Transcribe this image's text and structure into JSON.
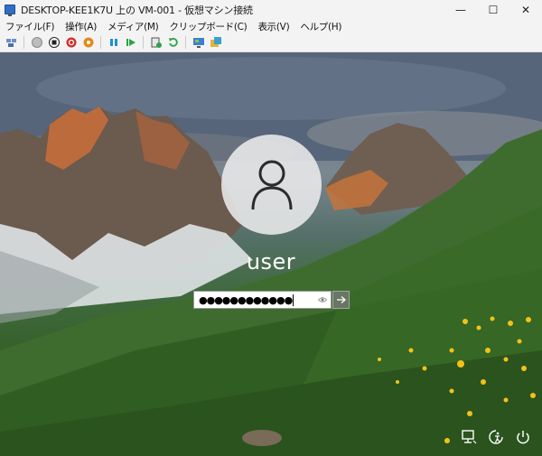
{
  "window": {
    "title": "DESKTOP-KEE1K7U 上の VM-001 - 仮想マシン接続",
    "minimize_glyph": "—",
    "maximize_glyph": "☐",
    "close_glyph": "✕"
  },
  "menu": {
    "items": [
      "ファイル(F)",
      "操作(A)",
      "メディア(M)",
      "クリップボード(C)",
      "表示(V)",
      "ヘルプ(H)"
    ]
  },
  "toolbar": {
    "icons": [
      "ctrl-alt-del-icon",
      "start-icon",
      "turn-off-icon",
      "shutdown-icon",
      "save-icon",
      "pause-icon",
      "resume-icon",
      "checkpoint-icon",
      "revert-icon",
      "enhanced-session-icon",
      "share-icon"
    ]
  },
  "login": {
    "username": "user",
    "password_mask": "●●●●●●●●●●●●",
    "reveal_icon": "eye-icon",
    "submit_icon": "arrow-right-icon"
  },
  "corner": {
    "icons": [
      "network-icon",
      "accessibility-icon",
      "power-icon"
    ]
  },
  "colors": {
    "titlebar_bg": "#f3f3f3",
    "username_text": "#ffffff",
    "avatar_bg": "#ebebeb"
  }
}
